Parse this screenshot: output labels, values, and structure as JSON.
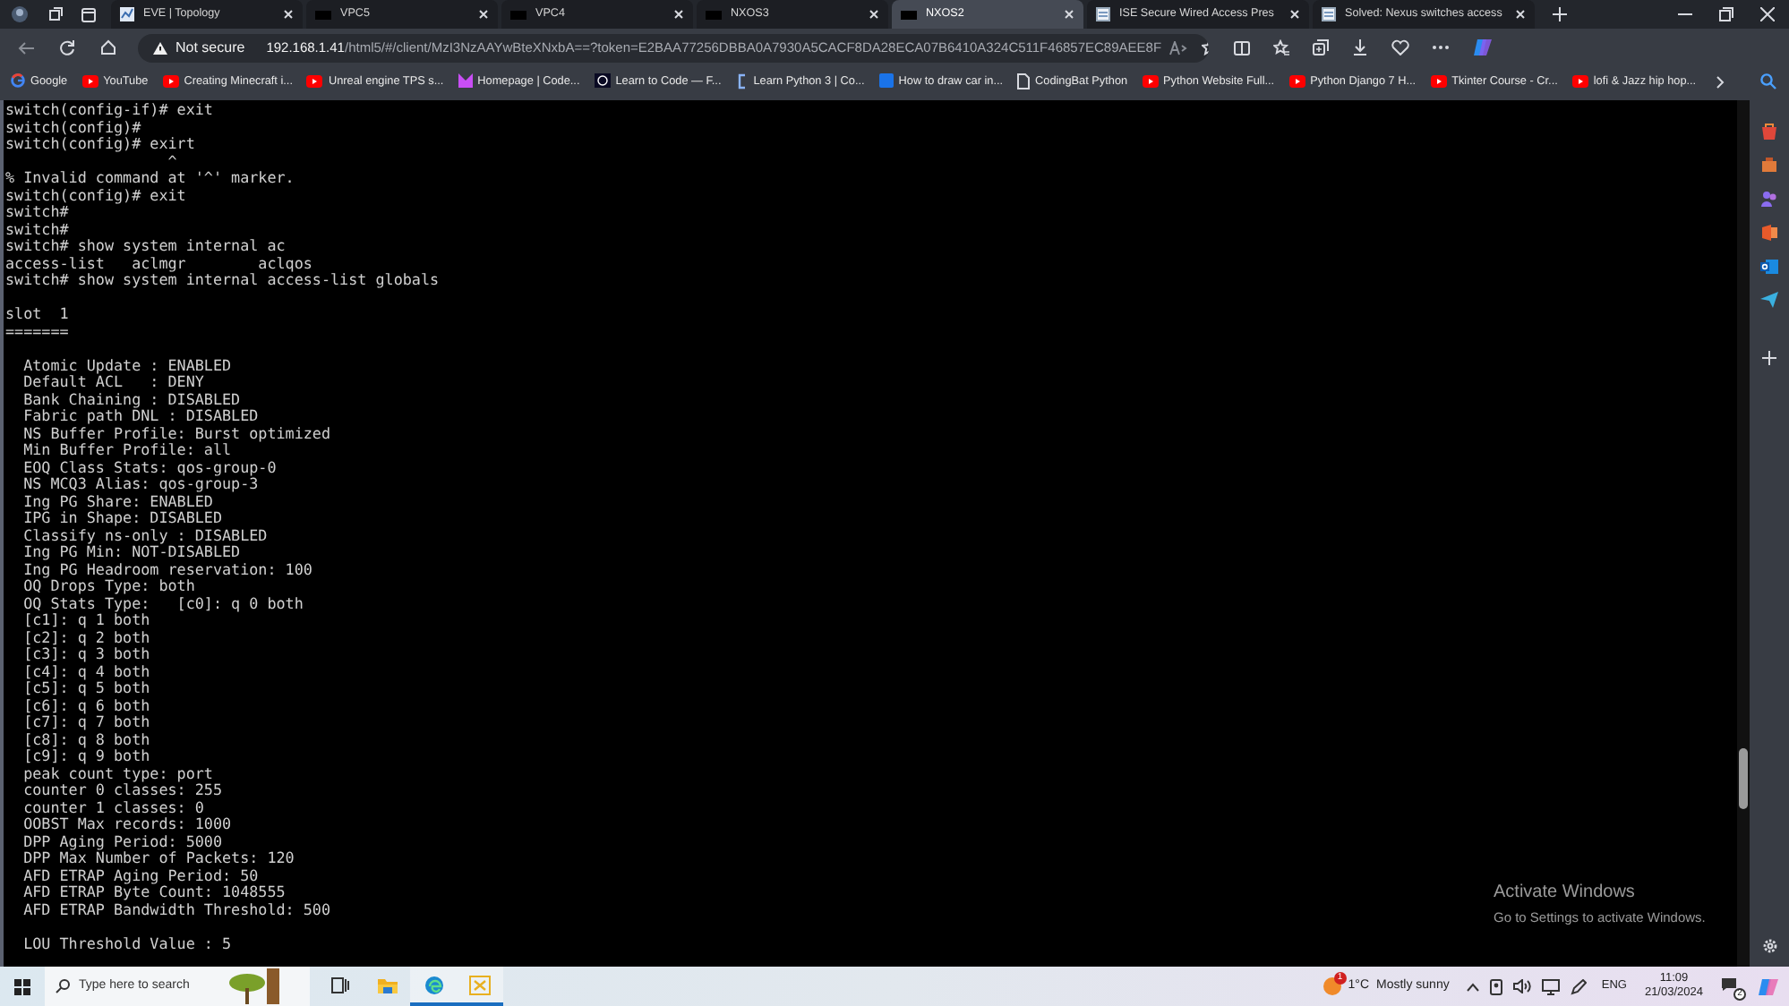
{
  "browser": {
    "tabs": [
      {
        "title": "EVE | Topology",
        "kind": "eve",
        "selected": false
      },
      {
        "title": "VPC5",
        "kind": "terminal",
        "selected": false
      },
      {
        "title": "VPC4",
        "kind": "terminal",
        "selected": false
      },
      {
        "title": "NXOS3",
        "kind": "terminal",
        "selected": false
      },
      {
        "title": "NXOS2",
        "kind": "terminal",
        "selected": true
      },
      {
        "title": "ISE Secure Wired Access Pres",
        "kind": "page",
        "selected": false
      },
      {
        "title": "Solved: Nexus switches access",
        "kind": "page",
        "selected": false
      }
    ],
    "security": "Not secure",
    "url": {
      "host": "192.168.1.41",
      "path": "/html5/#/client/MzI3NzAAYwBteXNxbA==?token=E2BAA77256DBBA0A7930A5CACF8DA28ECA07B6410A324C511F46857EC89AEE8F"
    },
    "bookmarks": [
      {
        "label": "Google",
        "kind": "google"
      },
      {
        "label": "YouTube",
        "kind": "youtube"
      },
      {
        "label": "Creating Minecraft i...",
        "kind": "youtube"
      },
      {
        "label": "Unreal engine TPS s...",
        "kind": "youtube"
      },
      {
        "label": "Homepage | Code...",
        "kind": "gradient"
      },
      {
        "label": "Learn to Code — F...",
        "kind": "dark"
      },
      {
        "label": "Learn Python 3 | Co...",
        "kind": "codecademy"
      },
      {
        "label": "How to draw car in...",
        "kind": "blue"
      },
      {
        "label": "CodingBat Python",
        "kind": "doc"
      },
      {
        "label": "Python Website Full...",
        "kind": "youtube"
      },
      {
        "label": "Python Django 7 H...",
        "kind": "youtube"
      },
      {
        "label": "Tkinter Course - Cr...",
        "kind": "youtube"
      },
      {
        "label": "lofi & Jazz hip hop...",
        "kind": "youtube"
      }
    ]
  },
  "terminal": {
    "blocks": [
      [
        "switch(config-if)# exit",
        "switch(config)#",
        "switch(config)# exirt",
        "                  ^",
        "% Invalid command at '^' marker.",
        "switch(config)# exit",
        "switch#",
        "switch#",
        "switch# show system internal ac",
        "access-list   aclmgr        aclqos",
        "switch# show system internal access-list globals"
      ],
      [
        "slot  1",
        "======="
      ],
      [
        "  Atomic Update : ENABLED",
        "  Default ACL   : DENY",
        "  Bank Chaining : DISABLED",
        "  Fabric path DNL : DISABLED",
        "  NS Buffer Profile: Burst optimized",
        "  Min Buffer Profile: all",
        "  EOQ Class Stats: qos-group-0",
        "  NS MCQ3 Alias: qos-group-3",
        "  Ing PG Share: ENABLED",
        "  IPG in Shape: DISABLED",
        "  Classify ns-only : DISABLED",
        "  Ing PG Min: NOT-DISABLED",
        "  Ing PG Headroom reservation: 100",
        "  OQ Drops Type: both",
        "  OQ Stats Type:   [c0]: q 0 both",
        "  [c1]: q 1 both",
        "  [c2]: q 2 both",
        "  [c3]: q 3 both",
        "  [c4]: q 4 both",
        "  [c5]: q 5 both",
        "  [c6]: q 6 both",
        "  [c7]: q 7 both",
        "  [c8]: q 8 both",
        "  [c9]: q 9 both",
        "  peak count type: port",
        "  counter 0 classes: 255",
        "  counter 1 classes: 0",
        "  OOBST Max records: 1000",
        "  DPP Aging Period: 5000",
        "  DPP Max Number of Packets: 120",
        "  AFD ETRAP Aging Period: 50",
        "  AFD ETRAP Byte Count: 1048555",
        "  AFD ETRAP Bandwidth Threshold: 500"
      ],
      [
        "  LOU Threshold Value : 5"
      ]
    ]
  },
  "activation": {
    "title": "Activate Windows",
    "subtitle": "Go to Settings to activate Windows."
  },
  "taskbar": {
    "search_placeholder": "Type here to search",
    "apps": [
      {
        "kind": "taskview",
        "active": false
      },
      {
        "kind": "explorer",
        "active": false
      },
      {
        "kind": "edge",
        "active": true
      },
      {
        "kind": "eve",
        "active": true
      }
    ],
    "weather": {
      "badge": "1",
      "temperature": "1°C",
      "condition": "Mostly sunny"
    },
    "language": "ENG",
    "time": "11:09",
    "date": "21/03/2024",
    "notifications": "2"
  }
}
